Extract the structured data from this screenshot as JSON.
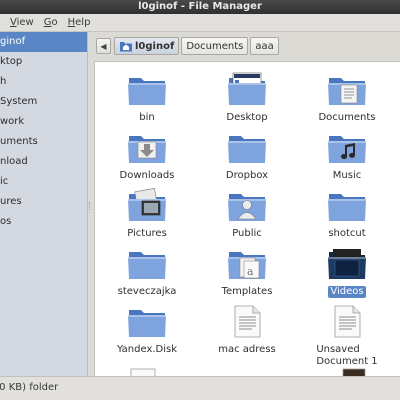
{
  "window": {
    "title": "l0ginof - File Manager"
  },
  "menubar": {
    "items": [
      {
        "label": "View",
        "mnemonic": "V"
      },
      {
        "label": "Go",
        "mnemonic": "G"
      },
      {
        "label": "Help",
        "mnemonic": "H"
      }
    ]
  },
  "sidebar": {
    "items": [
      {
        "label": "ginof",
        "selected": true
      },
      {
        "label": "ktop",
        "selected": false
      },
      {
        "label": "h",
        "selected": false
      },
      {
        "label": "System",
        "selected": false
      },
      {
        "label": "work",
        "selected": false
      },
      {
        "label": "uments",
        "selected": false
      },
      {
        "label": "nload",
        "selected": false
      },
      {
        "label": "ic",
        "selected": false
      },
      {
        "label": "ures",
        "selected": false
      },
      {
        "label": "os",
        "selected": false
      }
    ]
  },
  "pathbar": {
    "back_icon": "triangle-left-icon",
    "crumbs": [
      {
        "label": "l0ginof",
        "icon": "home-folder-icon",
        "active": true
      },
      {
        "label": "Documents",
        "active": false
      },
      {
        "label": "aaa",
        "active": false
      }
    ]
  },
  "files": [
    {
      "name": "bin",
      "icon": "folder-icon"
    },
    {
      "name": "Desktop",
      "icon": "folder-desktop-icon"
    },
    {
      "name": "Documents",
      "icon": "folder-documents-icon"
    },
    {
      "name": "Downloads",
      "icon": "folder-download-icon"
    },
    {
      "name": "Dropbox",
      "icon": "folder-icon"
    },
    {
      "name": "Music",
      "icon": "folder-music-icon"
    },
    {
      "name": "Pictures",
      "icon": "folder-pictures-icon"
    },
    {
      "name": "Public",
      "icon": "folder-public-icon"
    },
    {
      "name": "shotcut",
      "icon": "folder-icon"
    },
    {
      "name": "steveczajka",
      "icon": "folder-icon"
    },
    {
      "name": "Templates",
      "icon": "folder-templates-icon"
    },
    {
      "name": "Videos",
      "icon": "folder-videos-icon",
      "selected": true
    },
    {
      "name": "Yandex.Disk",
      "icon": "folder-icon"
    },
    {
      "name": "mac adress",
      "icon": "text-document-icon"
    },
    {
      "name": "Unsaved Document 1",
      "icon": "text-document-icon",
      "label_lines": [
        "Unsaved",
        "Document 1"
      ]
    }
  ],
  "statusbar": {
    "text": ".0 KB) folder"
  },
  "colors": {
    "folder": "#4a76bf",
    "folder_light": "#7ea3dd",
    "selection": "#5b86c5",
    "folder_dark": "#1d3a63"
  }
}
